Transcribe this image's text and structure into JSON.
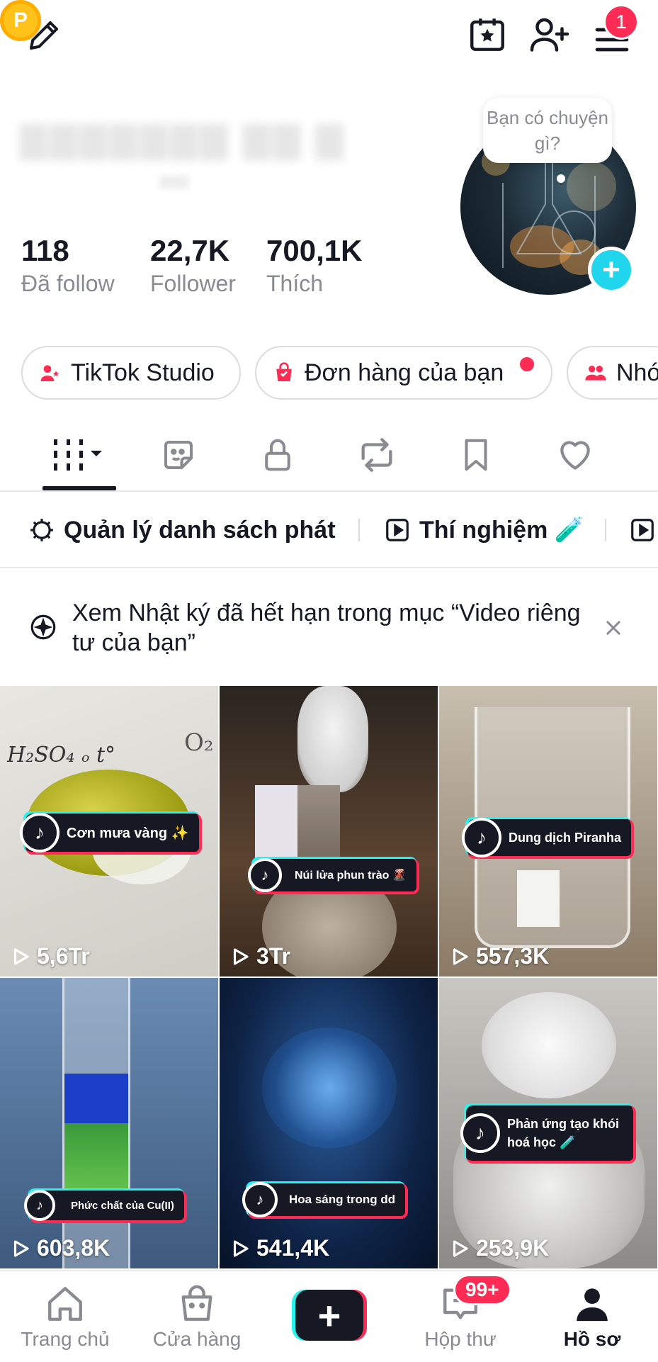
{
  "header": {
    "coin_label": "P",
    "menu_badge": "1",
    "bubble_text": "Bạn có chuyện gì?"
  },
  "stats": [
    {
      "value": "118",
      "label": "Đã follow"
    },
    {
      "value": "22,7K",
      "label": "Follower"
    },
    {
      "value": "700,1K",
      "label": "Thích"
    }
  ],
  "chips": [
    {
      "label": "TikTok Studio"
    },
    {
      "label": "Đơn hàng của bạn"
    },
    {
      "label": "Nhó"
    }
  ],
  "tabs": [
    "videos-grid-icon",
    "stickers-icon",
    "lock-icon",
    "repost-icon",
    "bookmark-icon",
    "heart-icon"
  ],
  "playlists": {
    "manage_label": "Quản lý danh sách phát",
    "items": [
      {
        "label": "Thí nghiệm 🧪"
      }
    ]
  },
  "notice": {
    "text": "Xem Nhật ký đã hết hạn trong mục “Video riêng tư của bạn”"
  },
  "videos": [
    {
      "title": "Cơn mưa vàng ✨",
      "views": "5,6Tr"
    },
    {
      "title": "Núi lửa phun trào 🌋",
      "views": "3Tr"
    },
    {
      "title": "Dung dịch Piranha",
      "views": "557,3K"
    },
    {
      "title": "Phức chất của Cu(II)",
      "views": "603,8K"
    },
    {
      "title": "Hoa sáng trong dd",
      "views": "541,4K"
    },
    {
      "title": "Phản ứng tạo khói hoá học 🧪",
      "views": "253,9K"
    }
  ],
  "nav": {
    "home": "Trang chủ",
    "shop": "Cửa hàng",
    "inbox": "Hộp thư",
    "inbox_badge": "99+",
    "profile": "Hồ sơ"
  },
  "colors": {
    "accent": "#fe2c55",
    "cyan": "#25f4ee",
    "plus": "#20d5ec"
  }
}
